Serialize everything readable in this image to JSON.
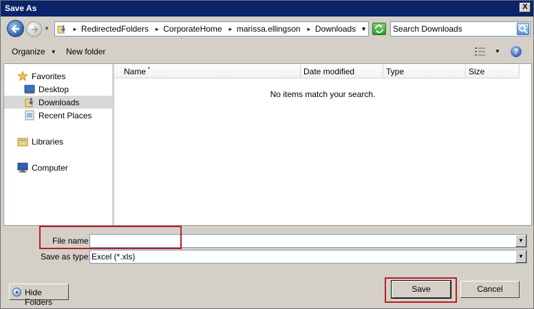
{
  "window": {
    "title": "Save As",
    "close_glyph": "X"
  },
  "nav": {
    "back_icon": "back-arrow-icon",
    "forward_icon": "forward-arrow-icon",
    "breadcrumbs": [
      "RedirectedFolders",
      "CorporateHome",
      "marissa.ellingson",
      "Downloads"
    ],
    "search_placeholder": "Search Downloads"
  },
  "toolbar": {
    "organize_label": "Organize",
    "new_folder_label": "New folder",
    "help_glyph": "?"
  },
  "sidebar": {
    "items": [
      {
        "label": "Favorites",
        "icon": "star-icon"
      },
      {
        "label": "Desktop",
        "icon": "desktop-icon"
      },
      {
        "label": "Downloads",
        "icon": "downloads-folder-icon",
        "selected": true
      },
      {
        "label": "Recent Places",
        "icon": "recent-places-icon"
      },
      {
        "label": "Libraries",
        "icon": "libraries-icon"
      },
      {
        "label": "Computer",
        "icon": "computer-icon"
      }
    ]
  },
  "file_list": {
    "columns": [
      "Name",
      "Date modified",
      "Type",
      "Size"
    ],
    "empty_message": "No items match your search."
  },
  "form": {
    "file_name_label": "File name:",
    "file_name_value": "",
    "save_as_type_label": "Save as type:",
    "save_as_type_value": "Excel (*.xls)"
  },
  "buttons": {
    "hide_folders": "Hide Folders",
    "save": "Save",
    "cancel": "Cancel"
  },
  "colors": {
    "highlight_box": "#b81c22",
    "title_bar": "#0a246a"
  }
}
